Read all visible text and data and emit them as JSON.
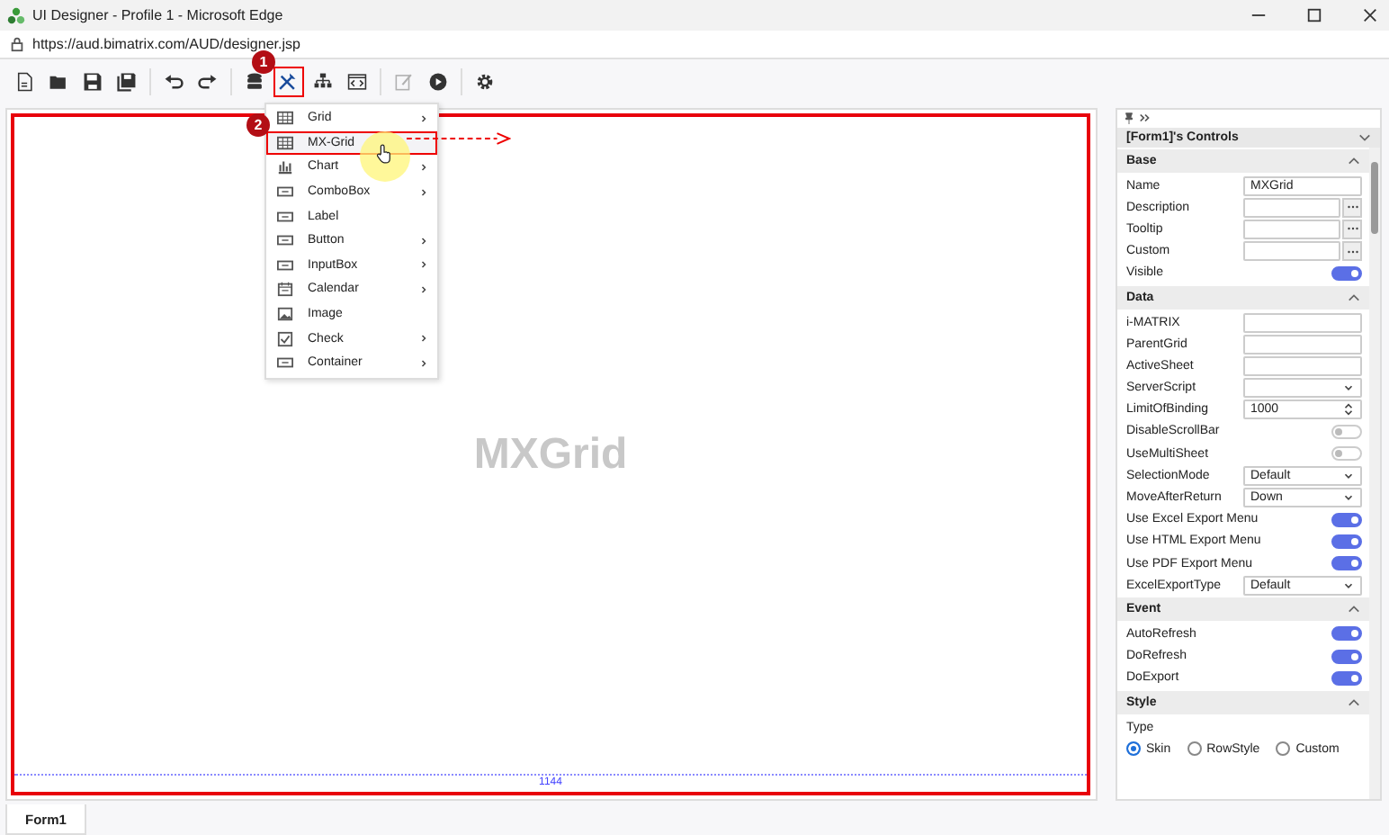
{
  "window": {
    "title": "UI Designer - Profile 1 - Microsoft Edge",
    "url": "https://aud.bimatrix.com/AUD/designer.jsp"
  },
  "toolbar": [
    [
      {
        "selected": false,
        "disabled": false
      },
      {
        "selected": false,
        "disabled": false
      },
      {
        "selected": false,
        "disabled": false
      },
      {
        "selected": false,
        "disabled": false
      }
    ],
    [
      {
        "selected": false,
        "disabled": false
      },
      {
        "selected": false,
        "disabled": false
      }
    ],
    [
      {
        "selected": false,
        "disabled": false
      },
      {
        "selected": true,
        "disabled": false
      },
      {
        "selected": false,
        "disabled": false
      },
      {
        "selected": false,
        "disabled": false
      }
    ],
    [
      {
        "selected": false,
        "disabled": true
      },
      {
        "selected": false,
        "disabled": false
      }
    ],
    [
      {
        "selected": false,
        "disabled": false
      }
    ]
  ],
  "step_badges": [
    "1",
    "2"
  ],
  "menu": [
    {
      "label": "Grid",
      "submenu": true,
      "selected": false
    },
    {
      "label": "MX-Grid",
      "submenu": false,
      "selected": true
    },
    {
      "label": "Chart",
      "submenu": true,
      "selected": false
    },
    {
      "label": "ComboBox",
      "submenu": true,
      "selected": false
    },
    {
      "label": "Label",
      "submenu": false,
      "selected": false
    },
    {
      "label": "Button",
      "submenu": true,
      "selected": false
    },
    {
      "label": "InputBox",
      "submenu": true,
      "selected": false
    },
    {
      "label": "Calendar",
      "submenu": true,
      "selected": false
    },
    {
      "label": "Image",
      "submenu": false,
      "selected": false
    },
    {
      "label": "Check",
      "submenu": true,
      "selected": false
    },
    {
      "label": "Container",
      "submenu": true,
      "selected": false
    }
  ],
  "canvas": {
    "control_name": "MXGrid",
    "width_label": "1144"
  },
  "panel": {
    "title": "[Form1]'s Controls",
    "sections": [
      {
        "title": "Base",
        "expanded": true,
        "rows": [
          {
            "kind": "text",
            "label": "Name",
            "value": "MXGrid"
          },
          {
            "kind": "dialog",
            "label": "Description"
          },
          {
            "kind": "dialog",
            "label": "Tooltip"
          },
          {
            "kind": "dialog",
            "label": "Custom"
          },
          {
            "kind": "toggle",
            "label": "Visible",
            "on": true
          }
        ]
      },
      {
        "title": "Data",
        "expanded": true,
        "rows": [
          {
            "kind": "text",
            "label": "i-MATRIX"
          },
          {
            "kind": "text",
            "label": "ParentGrid"
          },
          {
            "kind": "text",
            "label": "ActiveSheet"
          },
          {
            "kind": "select",
            "label": "ServerScript"
          },
          {
            "kind": "number",
            "label": "LimitOfBinding",
            "value": "1000"
          },
          {
            "kind": "toggle",
            "label": "DisableScrollBar",
            "on": false
          },
          {
            "kind": "toggle",
            "label": "UseMultiSheet",
            "on": false
          },
          {
            "kind": "select",
            "label": "SelectionMode",
            "value": "Default"
          },
          {
            "kind": "select",
            "label": "MoveAfterReturn",
            "value": "Down"
          },
          {
            "kind": "toggle",
            "label": "Use Excel Export Menu",
            "on": true
          },
          {
            "kind": "toggle",
            "label": "Use HTML Export Menu",
            "on": true
          },
          {
            "kind": "toggle",
            "label": "Use PDF Export Menu",
            "on": true
          },
          {
            "kind": "select",
            "label": "ExcelExportType",
            "value": "Default"
          }
        ]
      },
      {
        "title": "Event",
        "expanded": true,
        "rows": [
          {
            "kind": "toggle",
            "label": "AutoRefresh",
            "on": true
          },
          {
            "kind": "toggle",
            "label": "DoRefresh",
            "on": true
          },
          {
            "kind": "toggle",
            "label": "DoExport",
            "on": true
          }
        ]
      },
      {
        "title": "Style",
        "expanded": true,
        "rows": [
          {
            "kind": "heading",
            "label": "Type"
          },
          {
            "kind": "radio",
            "options": [
              {
                "label": "Skin",
                "selected": true
              },
              {
                "label": "RowStyle",
                "selected": false
              },
              {
                "label": "Custom",
                "selected": false
              }
            ]
          }
        ]
      }
    ]
  },
  "tabs": [
    {
      "label": "Form1",
      "selected": true
    }
  ]
}
